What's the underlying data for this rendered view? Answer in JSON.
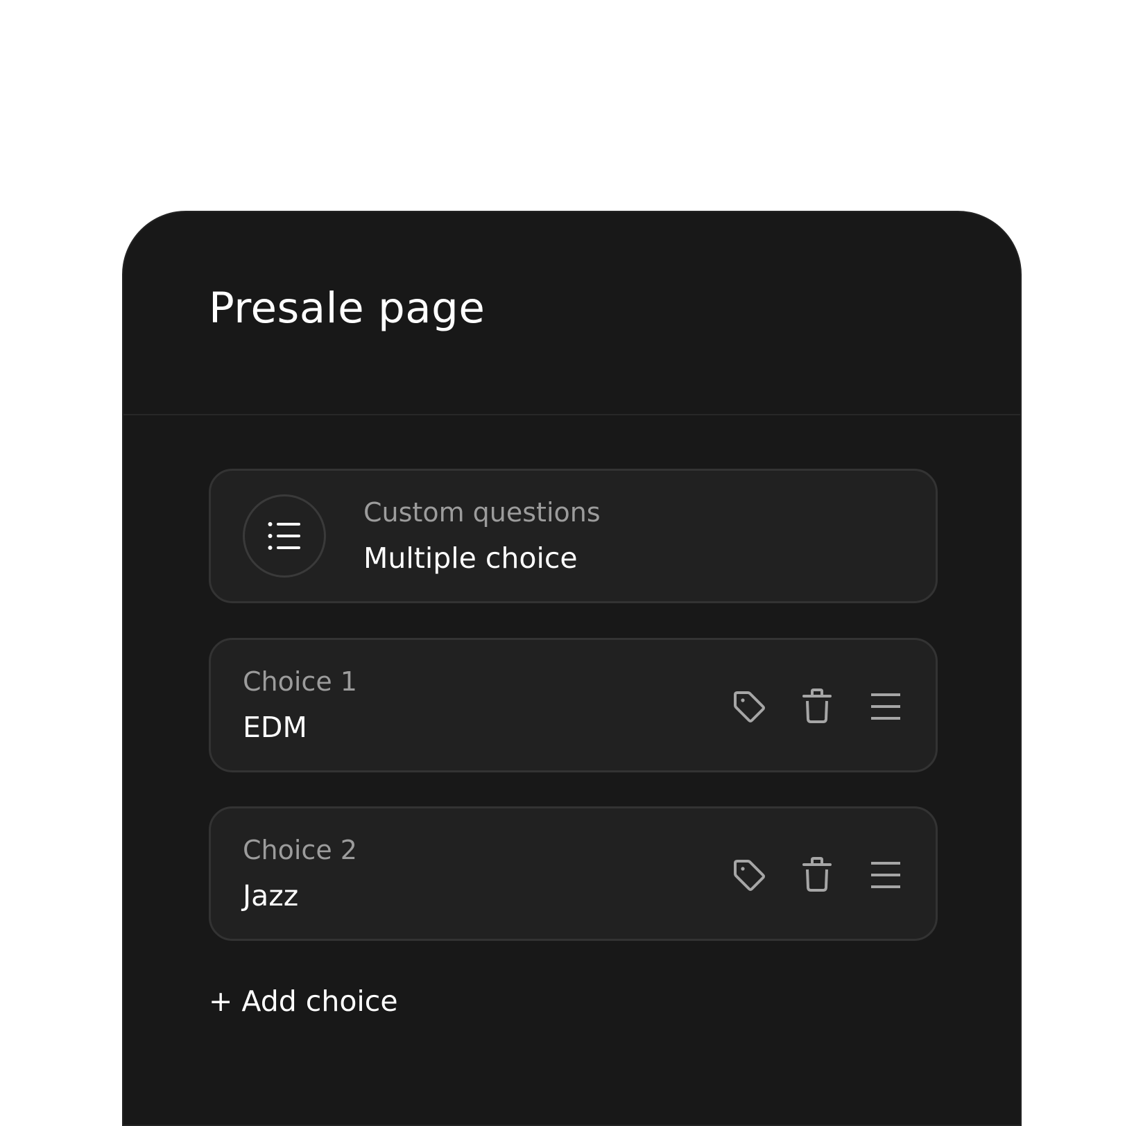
{
  "panel": {
    "title": "Presale page"
  },
  "question": {
    "icon": "list-icon",
    "label": "Custom questions",
    "value": "Multiple choice"
  },
  "choices": [
    {
      "label": "Choice 1",
      "value": "EDM"
    },
    {
      "label": "Choice 2",
      "value": "Jazz"
    }
  ],
  "choice_actions": [
    "tag-icon",
    "trash-icon",
    "drag-handle-icon"
  ],
  "add_choice_label": "+ Add choice",
  "colors": {
    "page_background": "#ffffff",
    "panel_background": "#181818",
    "card_background": "#212121",
    "card_border": "#333333",
    "label_text": "#9c9c9c",
    "value_text": "#ffffff",
    "icon_stroke": "#a6a6a6"
  }
}
